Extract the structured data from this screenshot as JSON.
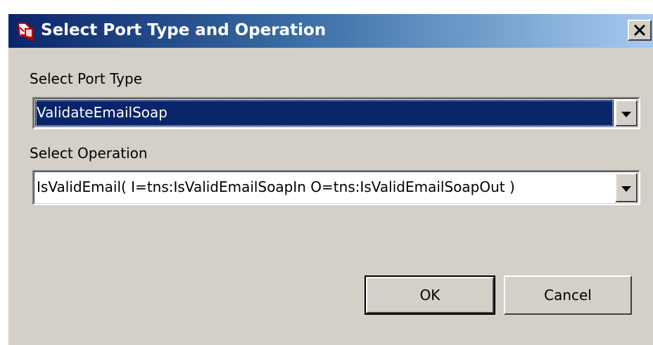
{
  "dialog": {
    "title": "Select Port Type and Operation",
    "title_icon": "service-icon",
    "close_icon": "close-icon"
  },
  "port_type": {
    "label": "Select Port Type",
    "selected": "ValidateEmailSoap"
  },
  "operation": {
    "label": "Select Operation",
    "selected": "IsValidEmail( I=tns:IsValidEmailSoapIn O=tns:IsValidEmailSoapOut )"
  },
  "buttons": {
    "ok": "OK",
    "cancel": "Cancel"
  },
  "colors": {
    "title_start": "#0a246a",
    "title_end": "#a6caf0",
    "selection": "#0a246a",
    "face": "#d4d0c8"
  }
}
